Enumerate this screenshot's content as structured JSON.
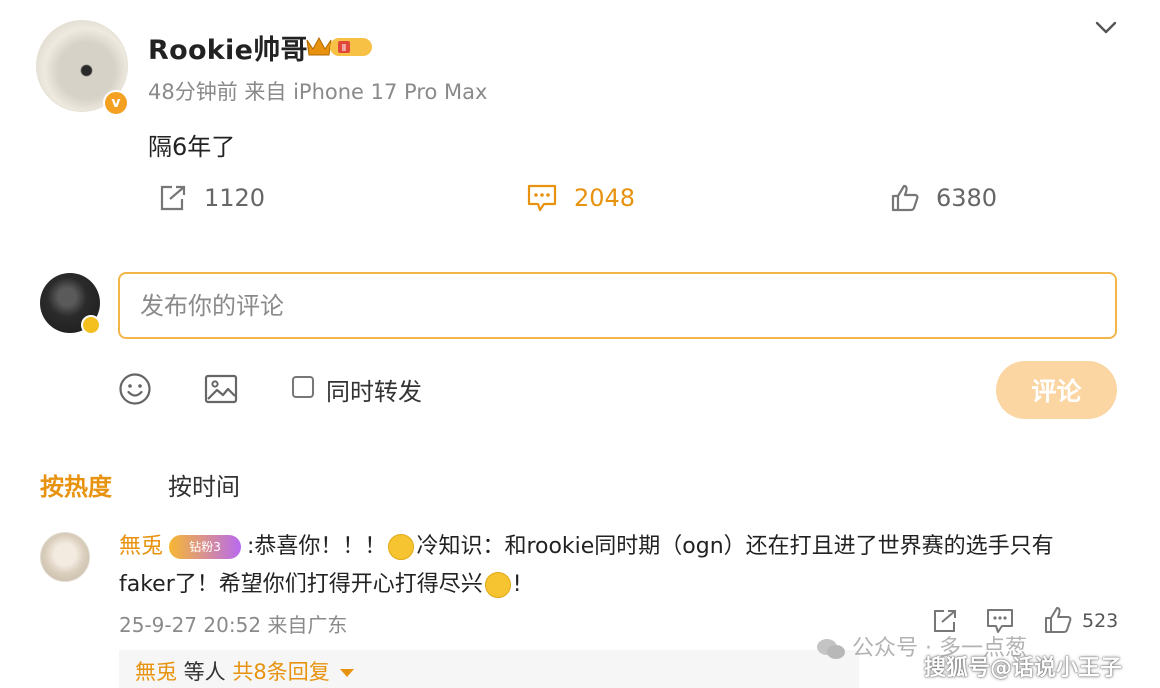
{
  "post": {
    "username": "Rookie帅哥",
    "meta": "48分钟前 来自 iPhone 17 Pro Max",
    "text": "隔6年了",
    "level_badge": "Ⅱ",
    "verified_icon": "v-badge-icon",
    "actions": {
      "repost_count": "1120",
      "comment_count": "2048",
      "like_count": "6380"
    }
  },
  "composer": {
    "placeholder": "发布你的评论",
    "also_repost_label": "同时转发",
    "submit_label": "评论"
  },
  "sort_tabs": {
    "hot": "按热度",
    "time": "按时间"
  },
  "comment": {
    "username": "無兎",
    "badge": "钻粉3",
    "text_part1": ":恭喜你！！！",
    "text_part2": "冷知识：和rookie同时期（ogn）还在打且进了世界赛的选手只有",
    "text_part3": "faker了！希望你们打得开心打得尽兴",
    "text_part4": "!",
    "meta": "25-9-27 20:52 来自广东",
    "like_count": "523",
    "reply_user": "無兎",
    "reply_mid": " 等人 ",
    "reply_count": "共8条回复"
  },
  "watermarks": {
    "wechat": "公众号 · 多一点葱",
    "sohu": "搜狐号@话说小王子"
  },
  "colors": {
    "accent": "#e8930f",
    "input_border": "#f2b64a",
    "submit_bg": "#fbd5a2",
    "muted_text": "#8a8a8a"
  }
}
